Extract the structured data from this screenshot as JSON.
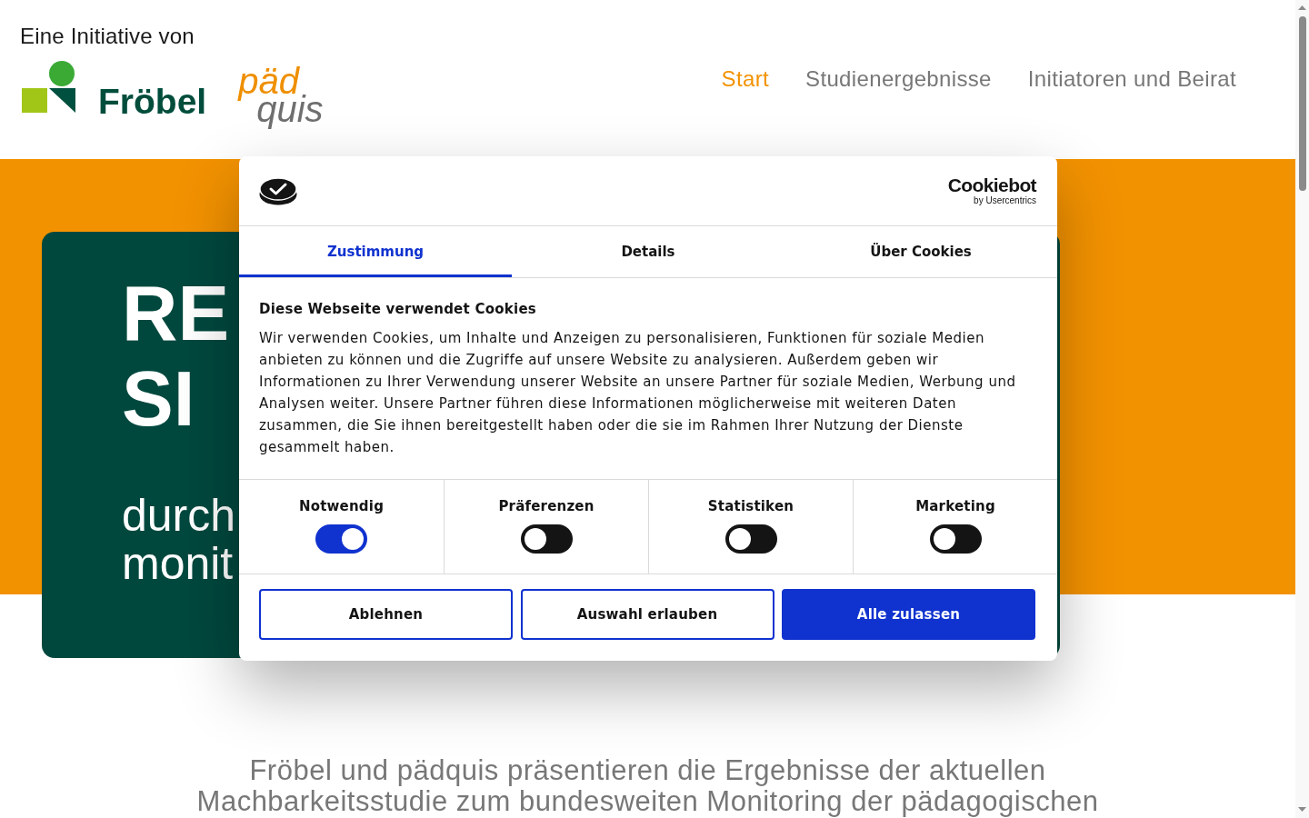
{
  "header": {
    "eyebrow": "Eine Initiative von",
    "logos": [
      {
        "kind": "froebel",
        "text": "Fröbel"
      },
      {
        "kind": "paedquis",
        "lines": [
          "päd",
          "quis"
        ]
      }
    ],
    "nav": [
      {
        "label": "Start",
        "selected": true
      },
      {
        "label": "Studienergebnisse",
        "selected": false
      },
      {
        "label": "Initiatoren und Beirat",
        "selected": false
      }
    ]
  },
  "hero": {
    "heading_lines": [
      "RE",
      "SI"
    ],
    "subtitle_lines": [
      "durch",
      "monit"
    ]
  },
  "intro": {
    "lines": [
      "Fröbel und pädquis präsentieren die Ergebnisse der aktuellen",
      "Machbarkeitsstudie zum bundesweiten Monitoring der pädagogischen"
    ]
  },
  "cookie_dialog": {
    "brand": {
      "name": "Cookiebot",
      "byline": "by Usercentrics"
    },
    "tabs": [
      {
        "label": "Zustimmung",
        "selected": true
      },
      {
        "label": "Details",
        "selected": false
      },
      {
        "label": "Über Cookies",
        "selected": false
      }
    ],
    "title": "Diese Webseite verwendet Cookies",
    "text": "Wir verwenden Cookies, um Inhalte und Anzeigen zu personalisieren, Funktionen für soziale Medien anbieten zu können und die Zugriffe auf unsere Website zu analysieren. Außerdem geben wir Informationen zu Ihrer Verwendung unserer Website an unsere Partner für soziale Medien, Werbung und Analysen weiter. Unsere Partner führen diese Informationen möglicherweise mit weiteren Daten zusammen, die Sie ihnen bereitgestellt haben oder die sie im Rahmen Ihrer Nutzung der Dienste gesammelt haben.",
    "categories": [
      {
        "label": "Notwendig",
        "checked": true
      },
      {
        "label": "Präferenzen",
        "checked": false
      },
      {
        "label": "Statistiken",
        "checked": false
      },
      {
        "label": "Marketing",
        "checked": false
      }
    ],
    "buttons": [
      {
        "label": "Ablehnen",
        "kind": "outline"
      },
      {
        "label": "Auswahl erlauben",
        "kind": "outline"
      },
      {
        "label": "Alle zulassen",
        "kind": "primary"
      }
    ]
  }
}
